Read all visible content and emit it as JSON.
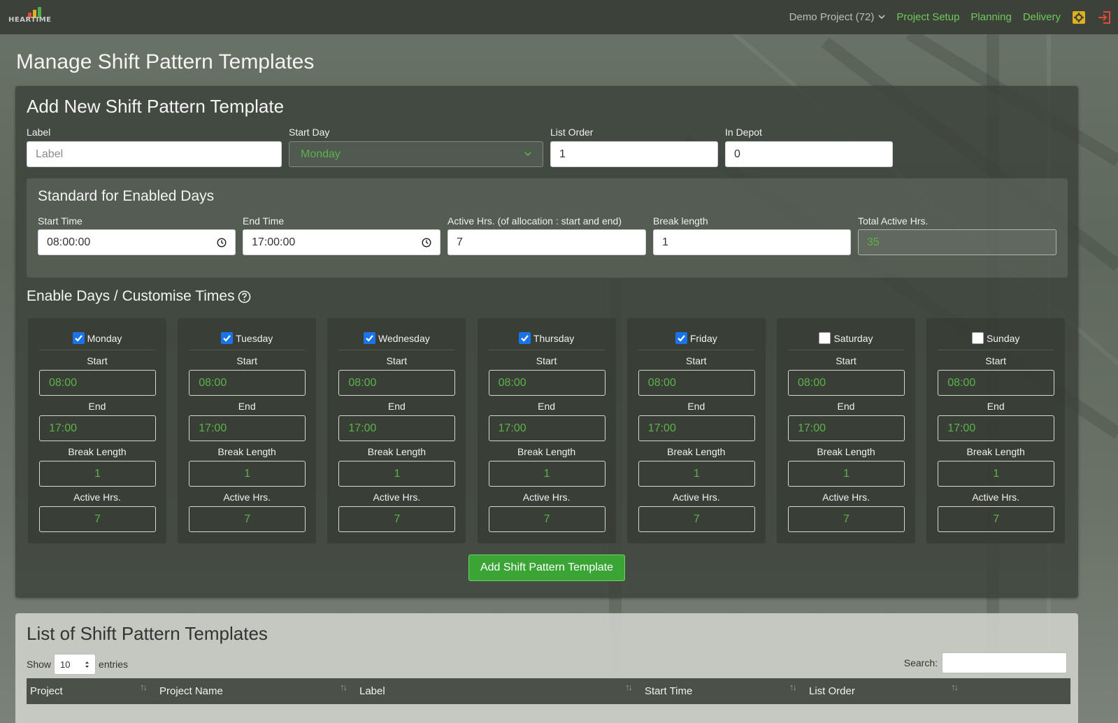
{
  "nav": {
    "logo_text": "HEARTIME",
    "project": "Demo Project (72)",
    "links": [
      "Project Setup",
      "Planning",
      "Delivery"
    ],
    "colors": {
      "bar": "#3c4239",
      "link": "#6fc95c",
      "settings_icon": "#e0b020",
      "logout_icon": "#e04a3a"
    }
  },
  "page_title": "Manage Shift Pattern Templates",
  "add_card": {
    "title": "Add New Shift Pattern Template",
    "label_label": "Label",
    "label_placeholder": "Label",
    "start_day_label": "Start Day",
    "start_day_value": "Monday",
    "list_order_label": "List Order",
    "list_order_value": "1",
    "in_depot_label": "In Depot",
    "in_depot_value": "0",
    "standard": {
      "title": "Standard for Enabled Days",
      "start_time_label": "Start Time",
      "start_time_value": "08:00:00",
      "end_time_label": "End Time",
      "end_time_value": "17:00:00",
      "active_label": "Active Hrs. (of allocation : start and end)",
      "active_value": "7",
      "break_label": "Break length",
      "break_value": "1",
      "total_label": "Total Active Hrs.",
      "total_value": "35"
    },
    "enable_title": "Enable Days / Customise Times",
    "day_labels": {
      "start": "Start",
      "end": "End",
      "break": "Break Length",
      "active": "Active Hrs."
    },
    "days": [
      {
        "name": "Monday",
        "checked": true,
        "start": "08:00",
        "end": "17:00",
        "break": "1",
        "active": "7"
      },
      {
        "name": "Tuesday",
        "checked": true,
        "start": "08:00",
        "end": "17:00",
        "break": "1",
        "active": "7"
      },
      {
        "name": "Wednesday",
        "checked": true,
        "start": "08:00",
        "end": "17:00",
        "break": "1",
        "active": "7"
      },
      {
        "name": "Thursday",
        "checked": true,
        "start": "08:00",
        "end": "17:00",
        "break": "1",
        "active": "7"
      },
      {
        "name": "Friday",
        "checked": true,
        "start": "08:00",
        "end": "17:00",
        "break": "1",
        "active": "7"
      },
      {
        "name": "Saturday",
        "checked": false,
        "start": "08:00",
        "end": "17:00",
        "break": "1",
        "active": "7"
      },
      {
        "name": "Sunday",
        "checked": false,
        "start": "08:00",
        "end": "17:00",
        "break": "1",
        "active": "7"
      }
    ],
    "submit_label": "Add Shift Pattern Template",
    "colors": {
      "accent_green": "#5db24b",
      "button": "#3aa534",
      "checkbox": "#1a73e8"
    }
  },
  "list_card": {
    "title": "List of Shift Pattern Templates",
    "show_label": "Show",
    "show_value": "10",
    "entries_label": "entries",
    "search_label": "Search:",
    "columns": [
      "Project",
      "Project Name",
      "Label",
      "Start Time",
      "List Order"
    ]
  }
}
